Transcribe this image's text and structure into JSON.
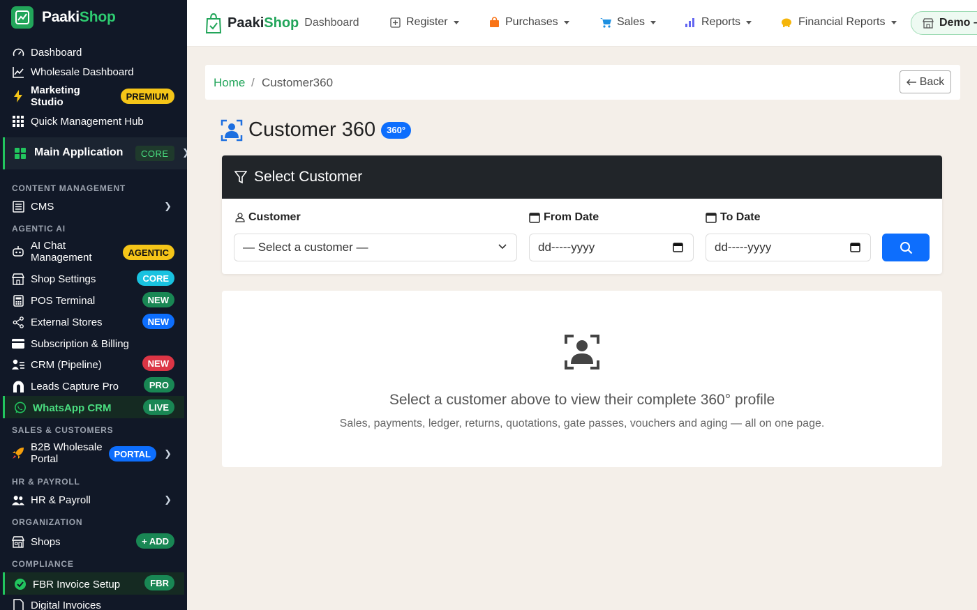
{
  "brand": {
    "name_a": "Paaki",
    "name_b": "Shop"
  },
  "sidebar": {
    "top_items": [
      {
        "label": "Dashboard"
      },
      {
        "label": "Wholesale Dashboard"
      },
      {
        "label_1": "Marketing",
        "label_2": "Studio",
        "badge": "PREMIUM"
      },
      {
        "label": "Quick Management Hub"
      }
    ],
    "main_app": {
      "label": "Main Application",
      "badge": "CORE"
    },
    "sections": {
      "content": "CONTENT MANAGEMENT",
      "agentic": "AGENTIC AI",
      "sales": "SALES & CUSTOMERS",
      "hr": "HR & PAYROLL",
      "org": "ORGANIZATION",
      "compliance": "COMPLIANCE"
    },
    "cms": "CMS",
    "ai_chat": {
      "label_1": "AI Chat",
      "label_2": "Management",
      "badge": "AGENTIC"
    },
    "shop_settings": {
      "label": "Shop Settings",
      "badge": "CORE"
    },
    "pos": {
      "label": "POS Terminal",
      "badge": "NEW"
    },
    "external": {
      "label": "External Stores",
      "badge": "NEW"
    },
    "subscription": {
      "label": "Subscription & Billing"
    },
    "crm": {
      "label": "CRM (Pipeline)",
      "badge": "NEW"
    },
    "leads": {
      "label": "Leads Capture Pro",
      "badge": "PRO"
    },
    "whatsapp": {
      "label": "WhatsApp CRM",
      "badge": "LIVE"
    },
    "b2b": {
      "label_1": "B2B Wholesale",
      "label_2": "Portal",
      "badge": "PORTAL"
    },
    "hr_payroll": "HR & Payroll",
    "shops": {
      "label": "Shops",
      "badge": "+ ADD"
    },
    "fbr": {
      "label": "FBR Invoice Setup",
      "badge": "FBR"
    },
    "digital": "Digital Invoices"
  },
  "topbar": {
    "brand_a": "Paaki",
    "brand_b": "Shop",
    "dashboard": "Dashboard",
    "nav": [
      "Register",
      "Purchases",
      "Sales",
      "Reports",
      "Financial Reports"
    ],
    "demo": "Demo –"
  },
  "breadcrumb": {
    "home": "Home",
    "sep": "/",
    "current": "Customer360",
    "back": "Back"
  },
  "title": {
    "text": "Customer 360",
    "badge": "360°"
  },
  "select_card": {
    "header": "Select Customer",
    "customer_label": "Customer",
    "customer_value": "— Select a customer —",
    "from_label": "From Date",
    "from_value": "dd-----yyyy",
    "to_label": "To Date",
    "to_value": "dd-----yyyy"
  },
  "empty_state": {
    "heading": "Select a customer above to view their complete 360° profile",
    "sub": "Sales, payments, ledger, returns, quotations, gate passes, vouchers and aging — all on one page."
  },
  "colors": {
    "accent_green": "#22a55a",
    "primary_blue": "#0d6efd",
    "sidebar_bg": "#111827"
  }
}
